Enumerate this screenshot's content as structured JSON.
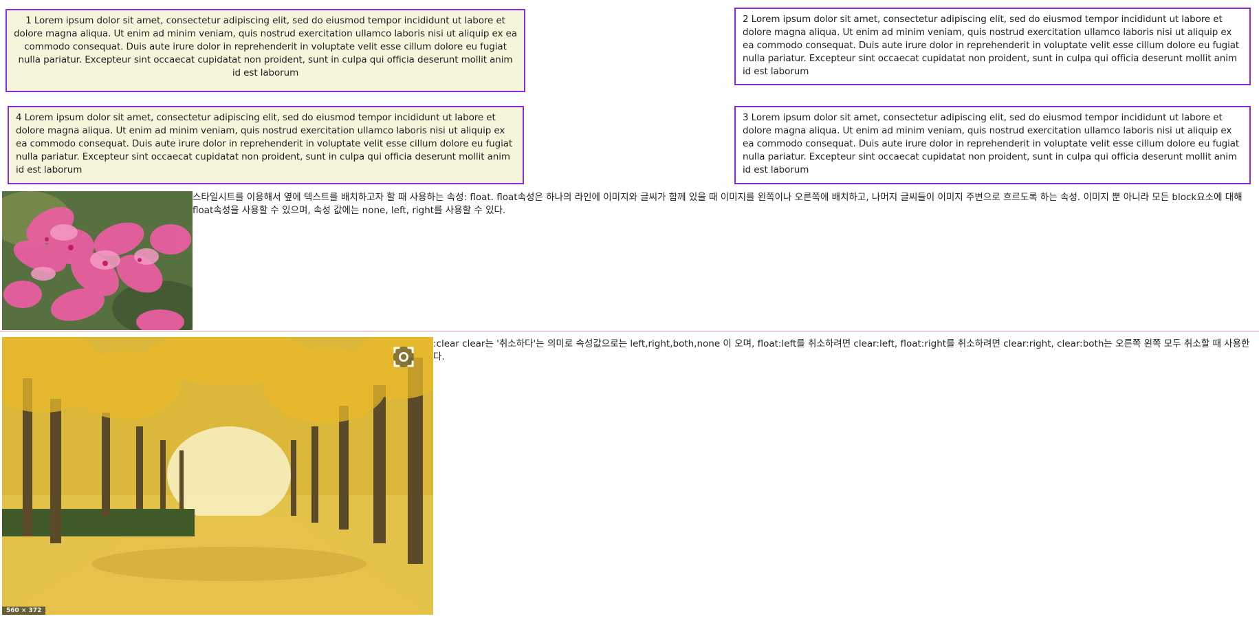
{
  "boxes": {
    "box1": "1 Lorem ipsum dolor sit amet, consectetur adipiscing elit, sed do eiusmod tempor incididunt ut labore et dolore magna aliqua. Ut enim ad minim veniam, quis nostrud exercitation ullamco laboris nisi ut aliquip ex ea commodo consequat. Duis aute irure dolor in reprehenderit in voluptate velit esse cillum dolore eu fugiat nulla pariatur. Excepteur sint occaecat cupidatat non proident, sunt in culpa qui officia deserunt mollit anim id est laborum",
    "box2": "2 Lorem ipsum dolor sit amet, consectetur adipiscing elit, sed do eiusmod tempor incididunt ut labore et dolore magna aliqua. Ut enim ad minim veniam, quis nostrud exercitation ullamco laboris nisi ut aliquip ex ea commodo consequat. Duis aute irure dolor in reprehenderit in voluptate velit esse cillum dolore eu fugiat nulla pariatur. Excepteur sint occaecat cupidatat non proident, sunt in culpa qui officia deserunt mollit anim id est laborum",
    "box3": "3 Lorem ipsum dolor sit amet, consectetur adipiscing elit, sed do eiusmod tempor incididunt ut labore et dolore magna aliqua. Ut enim ad minim veniam, quis nostrud exercitation ullamco laboris nisi ut aliquip ex ea commodo consequat. Duis aute irure dolor in reprehenderit in voluptate velit esse cillum dolore eu fugiat nulla pariatur. Excepteur sint occaecat cupidatat non proident, sunt in culpa qui officia deserunt mollit anim id est laborum",
    "box4": "4 Lorem ipsum dolor sit amet, consectetur adipiscing elit, sed do eiusmod tempor incididunt ut labore et dolore magna aliqua. Ut enim ad minim veniam, quis nostrud exercitation ullamco laboris nisi ut aliquip ex ea commodo consequat. Duis aute irure dolor in reprehenderit in voluptate velit esse cillum dolore eu fugiat nulla pariatur. Excepteur sint occaecat cupidatat non proident, sunt in culpa qui officia deserunt mollit anim id est laborum"
  },
  "float_section": {
    "text": "스타일시트를 이용해서 옆에 텍스트를 배치하고자 할 때 사용하는 속성: float. float속성은 하나의 라인에 이미지와 글씨가 함께 있을 때 이미지를 왼쪽이나 오른쪽에 배치하고, 나머지 글씨들이 이미지 주변으로 흐르도록 하는 속성. 이미지 뿐 아니라 모든 block요소에 대해 float속성을 사용할 수 있으며, 속성 값에는 none, left, right를 사용할 수 있다."
  },
  "clear_section": {
    "text": ":clear clear는 '취소하다'는 의미로 속성값으로는 left,right,both,none 이 오며, float:left를 취소하려면 clear:left, float:right를 취소하려면 clear:right, clear:both는 오른쪽 왼쪽 모두 취소할 때 사용한다.",
    "image_badge": "560 × 372"
  },
  "colors": {
    "box_border": "#8a2be2",
    "box_beige": "#f5f5dc",
    "divider": "#f2a0b0"
  },
  "icons": {
    "expand": "expand-icon"
  }
}
